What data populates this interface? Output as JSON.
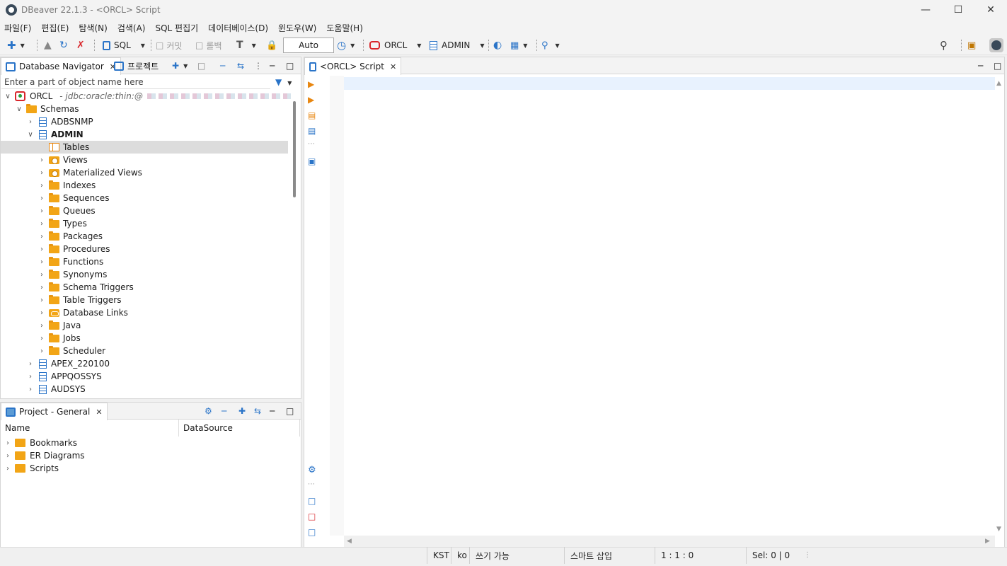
{
  "window": {
    "title": "DBeaver 22.1.3 - <ORCL> Script"
  },
  "menu": [
    "파일(F)",
    "편집(E)",
    "탐색(N)",
    "검색(A)",
    "SQL 편집기",
    "데이터베이스(D)",
    "윈도우(W)",
    "도움말(H)"
  ],
  "toolbar": {
    "sql_label": "SQL",
    "commit_label": "커밋",
    "rollback_label": "롤백",
    "transaction_mode": "Auto",
    "datasource": "ORCL",
    "schema": "ADMIN"
  },
  "navigator": {
    "tab_label": "Database Navigator",
    "projects_tab_label": "프로젝트",
    "filter_placeholder": "Enter a part of object name here",
    "connection": {
      "name": "ORCL",
      "url": "- jdbc:oracle:thin:@"
    },
    "schemas_label": "Schemas",
    "schemas_before": [
      "ADBSNMP"
    ],
    "expanded_schema": "ADMIN",
    "admin_children": [
      {
        "label": "Tables",
        "icon": "table-icon",
        "selected": true
      },
      {
        "label": "Views",
        "icon": "view-icon"
      },
      {
        "label": "Materialized Views",
        "icon": "view-icon"
      },
      {
        "label": "Indexes",
        "icon": "folder-icon"
      },
      {
        "label": "Sequences",
        "icon": "folder-icon"
      },
      {
        "label": "Queues",
        "icon": "folder-icon"
      },
      {
        "label": "Types",
        "icon": "folder-icon"
      },
      {
        "label": "Packages",
        "icon": "folder-icon"
      },
      {
        "label": "Procedures",
        "icon": "folder-icon"
      },
      {
        "label": "Functions",
        "icon": "folder-icon"
      },
      {
        "label": "Synonyms",
        "icon": "folder-icon"
      },
      {
        "label": "Schema Triggers",
        "icon": "folder-icon"
      },
      {
        "label": "Table Triggers",
        "icon": "folder-icon"
      },
      {
        "label": "Database Links",
        "icon": "link-icon"
      },
      {
        "label": "Java",
        "icon": "folder-icon"
      },
      {
        "label": "Jobs",
        "icon": "folder-icon"
      },
      {
        "label": "Scheduler",
        "icon": "folder-icon"
      }
    ],
    "schemas_after": [
      "APEX_220100",
      "APPQOSSYS",
      "AUDSYS"
    ]
  },
  "project": {
    "tab_label": "Project - General",
    "columns": [
      "Name",
      "DataSource"
    ],
    "items": [
      "Bookmarks",
      "ER Diagrams",
      "Scripts"
    ]
  },
  "editor": {
    "tab_label": "<ORCL> Script"
  },
  "status": {
    "tz": "KST",
    "locale": "ko",
    "mode": "쓰기 가능",
    "insert": "스마트 삽입",
    "position": "1 : 1 : 0",
    "selection": "Sel: 0 | 0"
  }
}
